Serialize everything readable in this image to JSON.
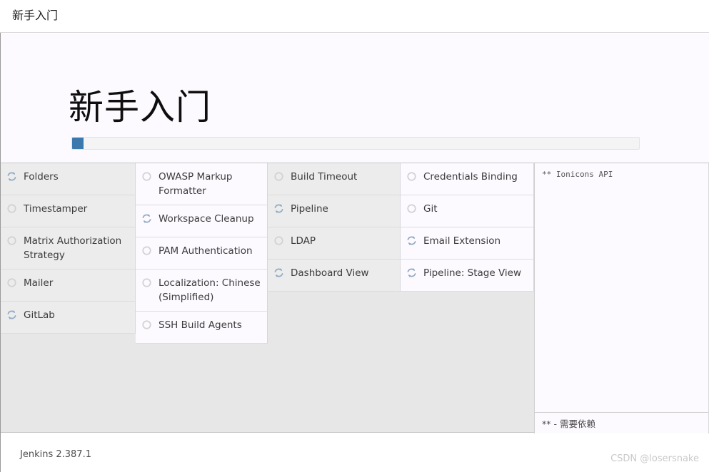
{
  "window": {
    "topbar_title": "新手入门"
  },
  "hero": {
    "title": "新手入门",
    "progress_percent": 2,
    "progress_fill_color": "#3b78ad",
    "progress_track_color": "#f4f4f4"
  },
  "plugin_grid": {
    "status_icons": {
      "installing": "sync-icon",
      "pending": "circle-pending-icon"
    },
    "columns": [
      {
        "shade": true,
        "cells": [
          {
            "label": "Folders",
            "status": "installing"
          },
          {
            "label": "Timestamper",
            "status": "pending"
          },
          {
            "label": "Matrix Authorization Strategy",
            "status": "pending"
          },
          {
            "label": "Mailer",
            "status": "pending"
          },
          {
            "label": "GitLab",
            "status": "installing"
          }
        ]
      },
      {
        "shade": false,
        "cells": [
          {
            "label": "OWASP Markup Formatter",
            "status": "pending"
          },
          {
            "label": "Workspace Cleanup",
            "status": "installing"
          },
          {
            "label": "PAM Authentication",
            "status": "pending"
          },
          {
            "label": "Localization: Chinese (Simplified)",
            "status": "pending"
          },
          {
            "label": "SSH Build Agents",
            "status": "pending"
          }
        ]
      },
      {
        "shade": true,
        "cells": [
          {
            "label": "Build Timeout",
            "status": "pending"
          },
          {
            "label": "Pipeline",
            "status": "installing"
          },
          {
            "label": "LDAP",
            "status": "pending"
          },
          {
            "label": "Dashboard View",
            "status": "installing"
          }
        ]
      },
      {
        "shade": false,
        "cells": [
          {
            "label": "Credentials Binding",
            "status": "pending"
          },
          {
            "label": "Git",
            "status": "pending"
          },
          {
            "label": "Email Extension",
            "status": "installing"
          },
          {
            "label": "Pipeline: Stage View",
            "status": "installing"
          }
        ]
      }
    ]
  },
  "log_panel": {
    "lines": [
      "** Ionicons API"
    ],
    "footer_note": "** - 需要依赖"
  },
  "footer": {
    "version_text": "Jenkins 2.387.1",
    "watermark": "CSDN @losersnake"
  }
}
